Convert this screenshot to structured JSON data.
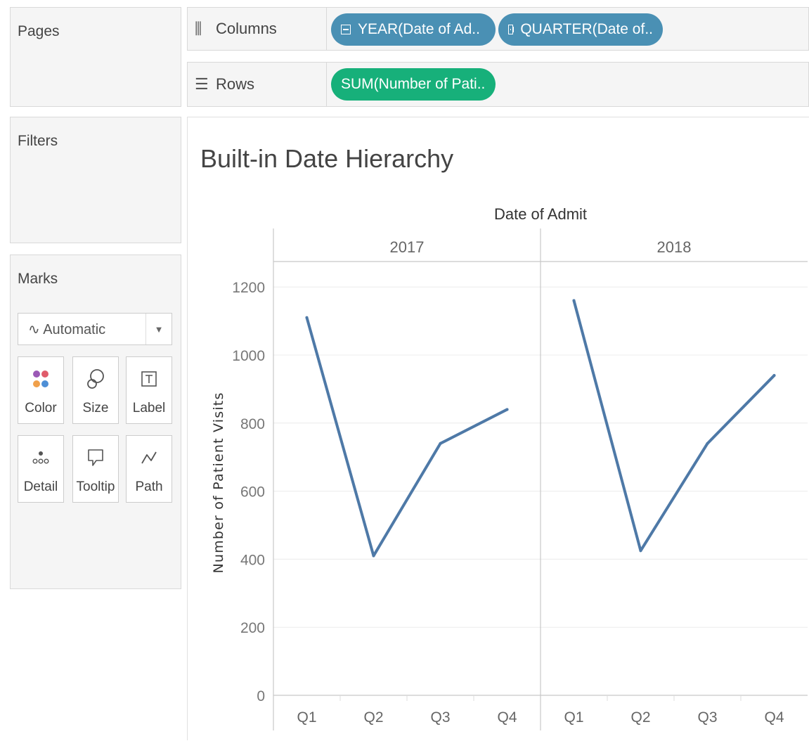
{
  "pages": {
    "title": "Pages"
  },
  "filters": {
    "title": "Filters"
  },
  "marks": {
    "title": "Marks",
    "type": "Automatic",
    "buttons": [
      {
        "label": "Color",
        "icon": "color-dots-icon"
      },
      {
        "label": "Size",
        "icon": "size-icon"
      },
      {
        "label": "Label",
        "icon": "label-icon"
      },
      {
        "label": "Detail",
        "icon": "detail-icon"
      },
      {
        "label": "Tooltip",
        "icon": "tooltip-icon"
      },
      {
        "label": "Path",
        "icon": "path-icon"
      }
    ]
  },
  "columns_shelf": {
    "label": "Columns",
    "pills": [
      {
        "text": "YEAR(Date of Ad..",
        "expand": "minus"
      },
      {
        "text": "QUARTER(Date of..",
        "expand": "plus"
      }
    ]
  },
  "rows_shelf": {
    "label": "Rows",
    "pills": [
      {
        "text": "SUM(Number of Pati.."
      }
    ]
  },
  "colors": {
    "line": "#4e79a7",
    "pill_blue": "#4a90b4",
    "pill_green": "#17b07a"
  },
  "chart_data": {
    "type": "line",
    "title": "Built-in Date Hierarchy",
    "column_header": "Date of Admit",
    "ylabel": "Number of Patient Visits",
    "ylim": [
      0,
      1250
    ],
    "yticks": [
      0,
      200,
      400,
      600,
      800,
      1000,
      1200
    ],
    "grid": true,
    "panels": [
      {
        "name": "2017",
        "categories": [
          "Q1",
          "Q2",
          "Q3",
          "Q4"
        ],
        "values": [
          1110,
          410,
          740,
          840
        ]
      },
      {
        "name": "2018",
        "categories": [
          "Q1",
          "Q2",
          "Q3",
          "Q4"
        ],
        "values": [
          1160,
          425,
          740,
          940
        ]
      }
    ]
  }
}
